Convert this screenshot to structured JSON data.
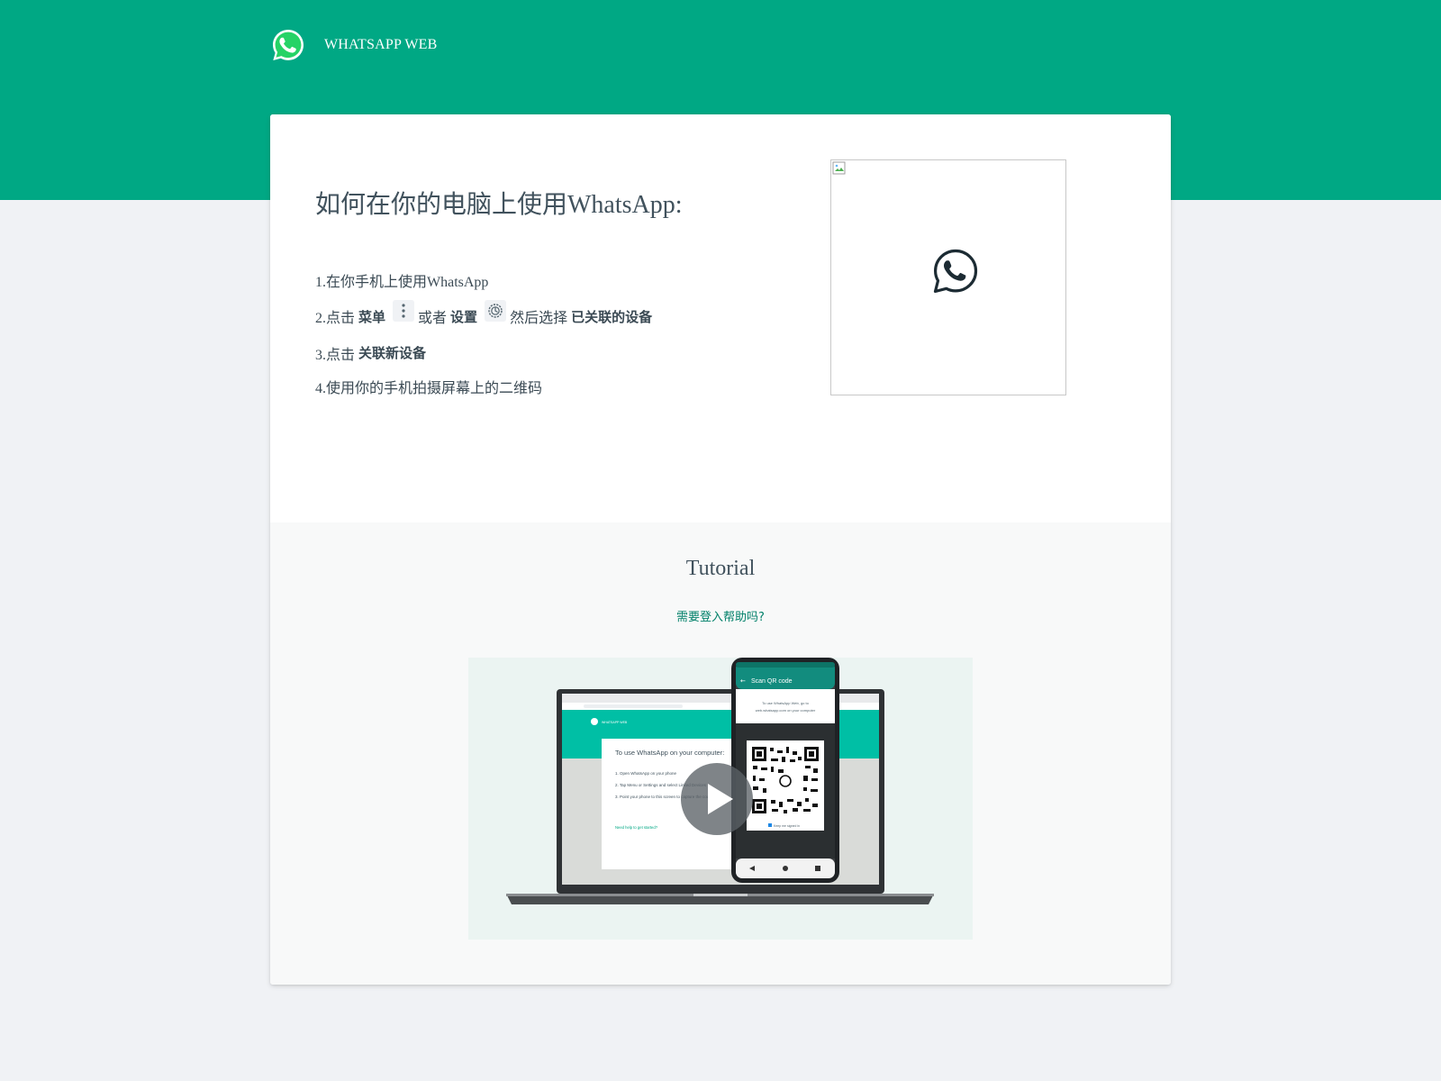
{
  "header": {
    "brand_text": "WHATSAPP WEB",
    "logo_icon": "whatsapp-logo-icon"
  },
  "landing": {
    "title": "如何在你的电脑上使用WhatsApp:",
    "steps": {
      "s1": "1.在你手机上使用WhatsApp",
      "s2_prefix": "2.点击",
      "s2_menu": "菜单",
      "s2_menu_icon": "kebab-menu-icon",
      "s2_or": "或者",
      "s2_settings": "设置",
      "s2_settings_icon": "settings-gear-icon",
      "s2_then": "然后选择",
      "s2_linked": "已关联的设备",
      "s3_prefix": "3.点击",
      "s3_link_new": "关联新设备",
      "s4": "4.使用你的手机拍摄屏幕上的二维码"
    },
    "qr_icon": "whatsapp-logo-icon"
  },
  "tutorial": {
    "title": "Tutorial",
    "help_link": "需要登入帮助吗?",
    "video": {
      "play_icon": "play-icon",
      "phone_header": "Scan QR code",
      "phone_note_line1": "To use WhatsApp Web, go to",
      "phone_note_line2": "web.whatsapp.com on your computer",
      "laptop_heading": "To use WhatsApp on your computer:",
      "laptop_step1": "1. Open WhatsApp on your phone",
      "laptop_step2": "2. Tap Menu or Settings and select Linked Devices",
      "laptop_step3": "3. Point your phone to this screen to capture the code",
      "laptop_link": "Need help to get started?",
      "laptop_brand": "WHATSAPP WEB",
      "phone_keep": "Keep me signed in"
    }
  },
  "colors": {
    "brand_green": "#00a884",
    "link_green": "#008069",
    "text_dark": "#41525d",
    "page_bg": "#f0f2f5"
  }
}
